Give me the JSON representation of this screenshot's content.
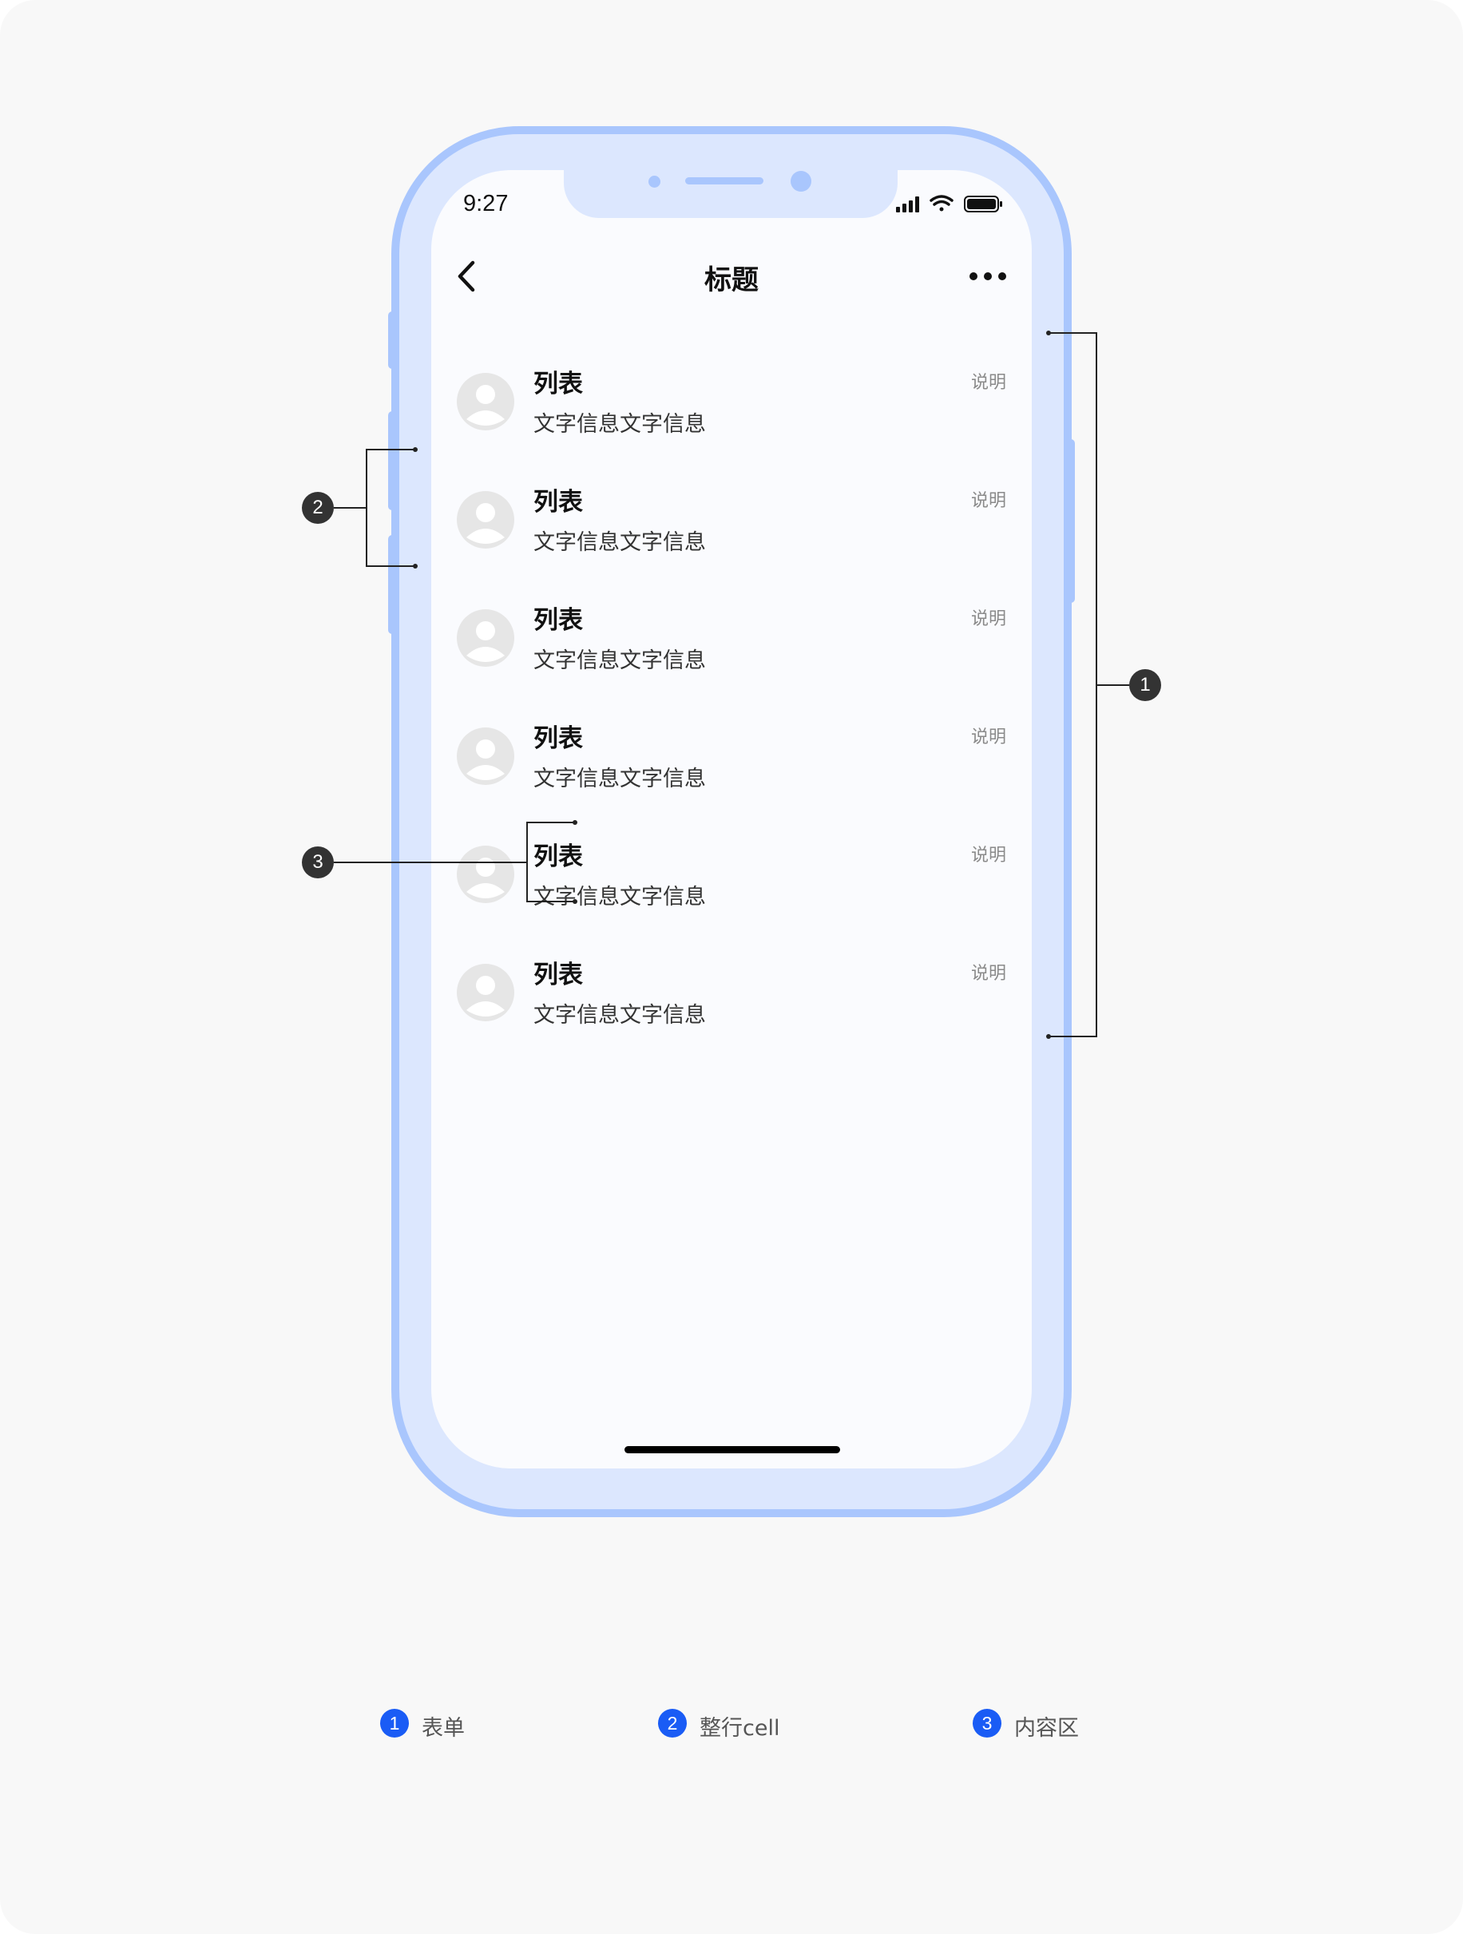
{
  "status_bar": {
    "time": "9:27"
  },
  "nav": {
    "title": "标题"
  },
  "list": [
    {
      "title": "列表",
      "desc": "文字信息文字信息",
      "note": "说明"
    },
    {
      "title": "列表",
      "desc": "文字信息文字信息",
      "note": "说明"
    },
    {
      "title": "列表",
      "desc": "文字信息文字信息",
      "note": "说明"
    },
    {
      "title": "列表",
      "desc": "文字信息文字信息",
      "note": "说明"
    },
    {
      "title": "列表",
      "desc": "文字信息文字信息",
      "note": "说明"
    },
    {
      "title": "列表",
      "desc": "文字信息文字信息",
      "note": "说明"
    }
  ],
  "callouts": [
    "1",
    "2",
    "3"
  ],
  "legend": [
    {
      "num": "1",
      "label": "表单"
    },
    {
      "num": "2",
      "label": "整行cell"
    },
    {
      "num": "3",
      "label": "内容区"
    }
  ],
  "colors": {
    "frame_fill": "#dce7fe",
    "frame_border": "#a9c6fd",
    "legend_badge": "#1a5cf5",
    "callout_badge": "#333333"
  },
  "icons": [
    "back-arrow-icon",
    "more-dots-icon",
    "signal-icon",
    "wifi-icon",
    "battery-icon",
    "avatar-placeholder-icon"
  ]
}
